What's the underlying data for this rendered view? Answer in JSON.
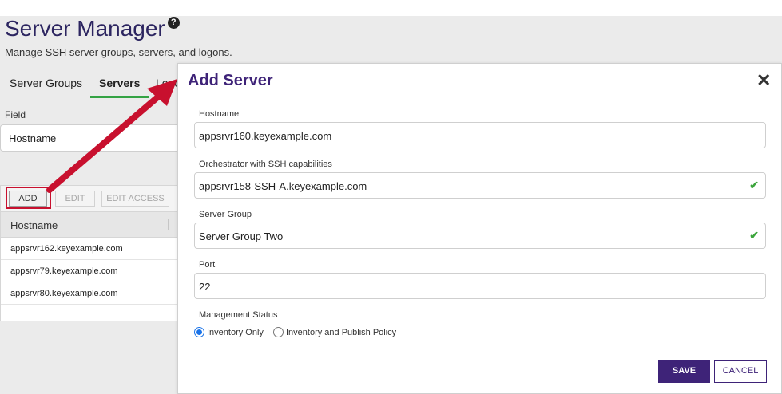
{
  "header": {
    "title": "Server Manager",
    "help_icon": "?",
    "subtitle": "Manage SSH server groups, servers, and logons."
  },
  "tabs": [
    {
      "label": "Server Groups",
      "active": false
    },
    {
      "label": "Servers",
      "active": true
    },
    {
      "label": "Logo",
      "active": false
    }
  ],
  "search": {
    "field_label": "Field",
    "field_value": "Hostname"
  },
  "toolbar": {
    "add_label": "ADD",
    "edit_label": "EDIT",
    "edit_access_label": "EDIT ACCESS"
  },
  "grid": {
    "column_header": "Hostname",
    "rows": [
      "appsrvr162.keyexample.com",
      "appsrvr79.keyexample.com",
      "appsrvr80.keyexample.com"
    ]
  },
  "modal": {
    "title": "Add Server",
    "close_icon": "✕",
    "hostname_label": "Hostname",
    "hostname_value": "appsrvr160.keyexample.com",
    "orchestrator_label": "Orchestrator with SSH capabilities",
    "orchestrator_value": "appsrvr158-SSH-A.keyexample.com",
    "server_group_label": "Server Group",
    "server_group_value": "Server Group Two",
    "port_label": "Port",
    "port_value": "22",
    "check_icon": "✔",
    "management_status_label": "Management Status",
    "status_options": [
      "Inventory Only",
      "Inventory and Publish Policy"
    ],
    "selected_status": "Inventory Only",
    "save_label": "SAVE",
    "cancel_label": "CANCEL"
  },
  "colors": {
    "brand_purple": "#3e2378",
    "title_navy": "#2c2560",
    "active_tab_underline": "#34a344",
    "highlight_red": "#c8102e",
    "valid_check": "#3ca53c"
  }
}
